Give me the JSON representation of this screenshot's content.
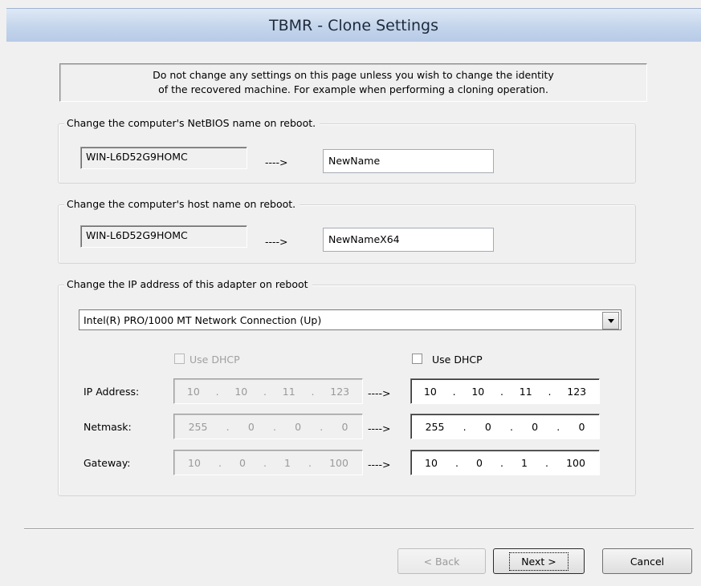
{
  "window": {
    "title": "TBMR - Clone Settings"
  },
  "info": {
    "line1": "Do not change any settings on this page unless you wish to change the identity",
    "line2": "of the recovered machine. For example when performing a cloning operation."
  },
  "netbios": {
    "legend": "Change the computer's NetBIOS name on reboot.",
    "current": "WIN-L6D52G9HOMC",
    "arrow": "---->",
    "new_value": "NewName"
  },
  "hostname": {
    "legend": "Change the computer's host name on reboot.",
    "current": "WIN-L6D52G9HOMC",
    "arrow": "---->",
    "new_value": "NewNameX64"
  },
  "ip": {
    "legend": "Change the IP address of this adapter on reboot",
    "adapter": "Intel(R) PRO/1000 MT Network Connection (Up)",
    "use_dhcp_label": "Use DHCP",
    "use_dhcp_checked": false,
    "arrow": "---->",
    "rows": [
      {
        "label": "IP Address:",
        "current": [
          "10",
          "10",
          "11",
          "123"
        ],
        "new": [
          "10",
          "10",
          "11",
          "123"
        ]
      },
      {
        "label": "Netmask:",
        "current": [
          "255",
          "0",
          "0",
          "0"
        ],
        "new": [
          "255",
          "0",
          "0",
          "0"
        ]
      },
      {
        "label": "Gateway:",
        "current": [
          "10",
          "0",
          "1",
          "100"
        ],
        "new": [
          "10",
          "0",
          "1",
          "100"
        ]
      }
    ]
  },
  "buttons": {
    "back": "< Back",
    "next": "Next >",
    "cancel": "Cancel"
  }
}
